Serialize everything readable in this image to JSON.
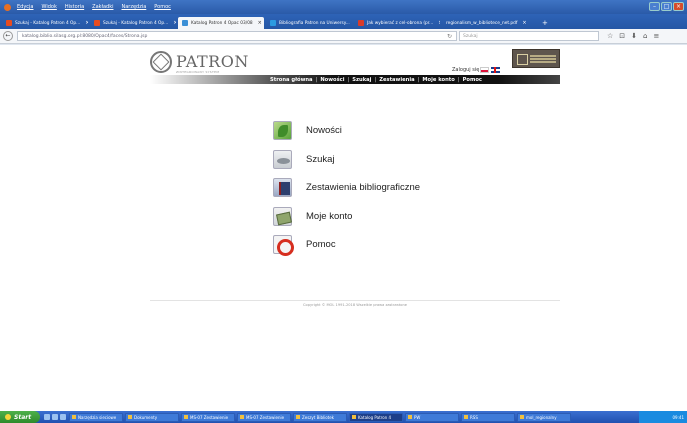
{
  "browser": {
    "menu": [
      "Edycja",
      "Widok",
      "Historia",
      "Zakładki",
      "Narzędzia",
      "Pomoc"
    ],
    "tabs": [
      {
        "label": "Szukaj - Katalog Patron 4 Op..."
      },
      {
        "label": "Szukaj - Katalog Patron 4 Op..."
      },
      {
        "label": "Katalog Patron 4 Opac 03/08",
        "active": true
      },
      {
        "label": "Bibliografia Patron na Uniwersy..."
      },
      {
        "label": "Jak wybierać z cel-obrona (pr..."
      },
      {
        "label": "regionalism_w_bibliotece_net.pdf"
      }
    ],
    "new_tab": "+",
    "url": "katalog.biblio.silasg.org.pl:8080/Opac4/faces/Strona.jsp",
    "search_placeholder": "Szukaj",
    "reload": "↻",
    "back": "←",
    "nav_icons": [
      "☆",
      "⊡",
      "⬇",
      "⌂",
      "≡"
    ]
  },
  "page": {
    "logo_text": "PATRON",
    "logo_sub": "ZINTEGROWANY SYSTEM",
    "login_label": "Zaloguj się",
    "nav": [
      "Strona główna",
      "Nowości",
      "Szukaj",
      "Zestawienia",
      "Moje konto",
      "Pomoc"
    ],
    "menu": [
      {
        "label": "Nowości",
        "icon": "new-leaf-icon"
      },
      {
        "label": "Szukaj",
        "icon": "search-icon"
      },
      {
        "label": "Zestawienia bibliograficzne",
        "icon": "book-icon"
      },
      {
        "label": "Moje konto",
        "icon": "account-icon"
      },
      {
        "label": "Pomoc",
        "icon": "help-lifebuoy-icon"
      }
    ],
    "copyright": "Copyright © MOL 1991-2018 Wszelkie prawa zastrzeżone"
  },
  "taskbar": {
    "start": "Start",
    "tasks": [
      {
        "label": "Narzędzia sieciowe"
      },
      {
        "label": "Dokumenty"
      },
      {
        "label": "MS-07 Zestawienie"
      },
      {
        "label": "MS-07 Zestawienie"
      },
      {
        "label": "Zeszyt Bibliotek"
      },
      {
        "label": "Katalog Patron 4",
        "active": true
      },
      {
        "label": "PW"
      },
      {
        "label": "RSS"
      },
      {
        "label": "mol_regionalny"
      }
    ],
    "clock": "09:41"
  },
  "colors": {
    "titlebar": "#2a5aa8",
    "page_bg": "#ffffff",
    "nav_strip": "#111111",
    "taskbar": "#2150b0",
    "start_button": "#2f8a2c"
  }
}
